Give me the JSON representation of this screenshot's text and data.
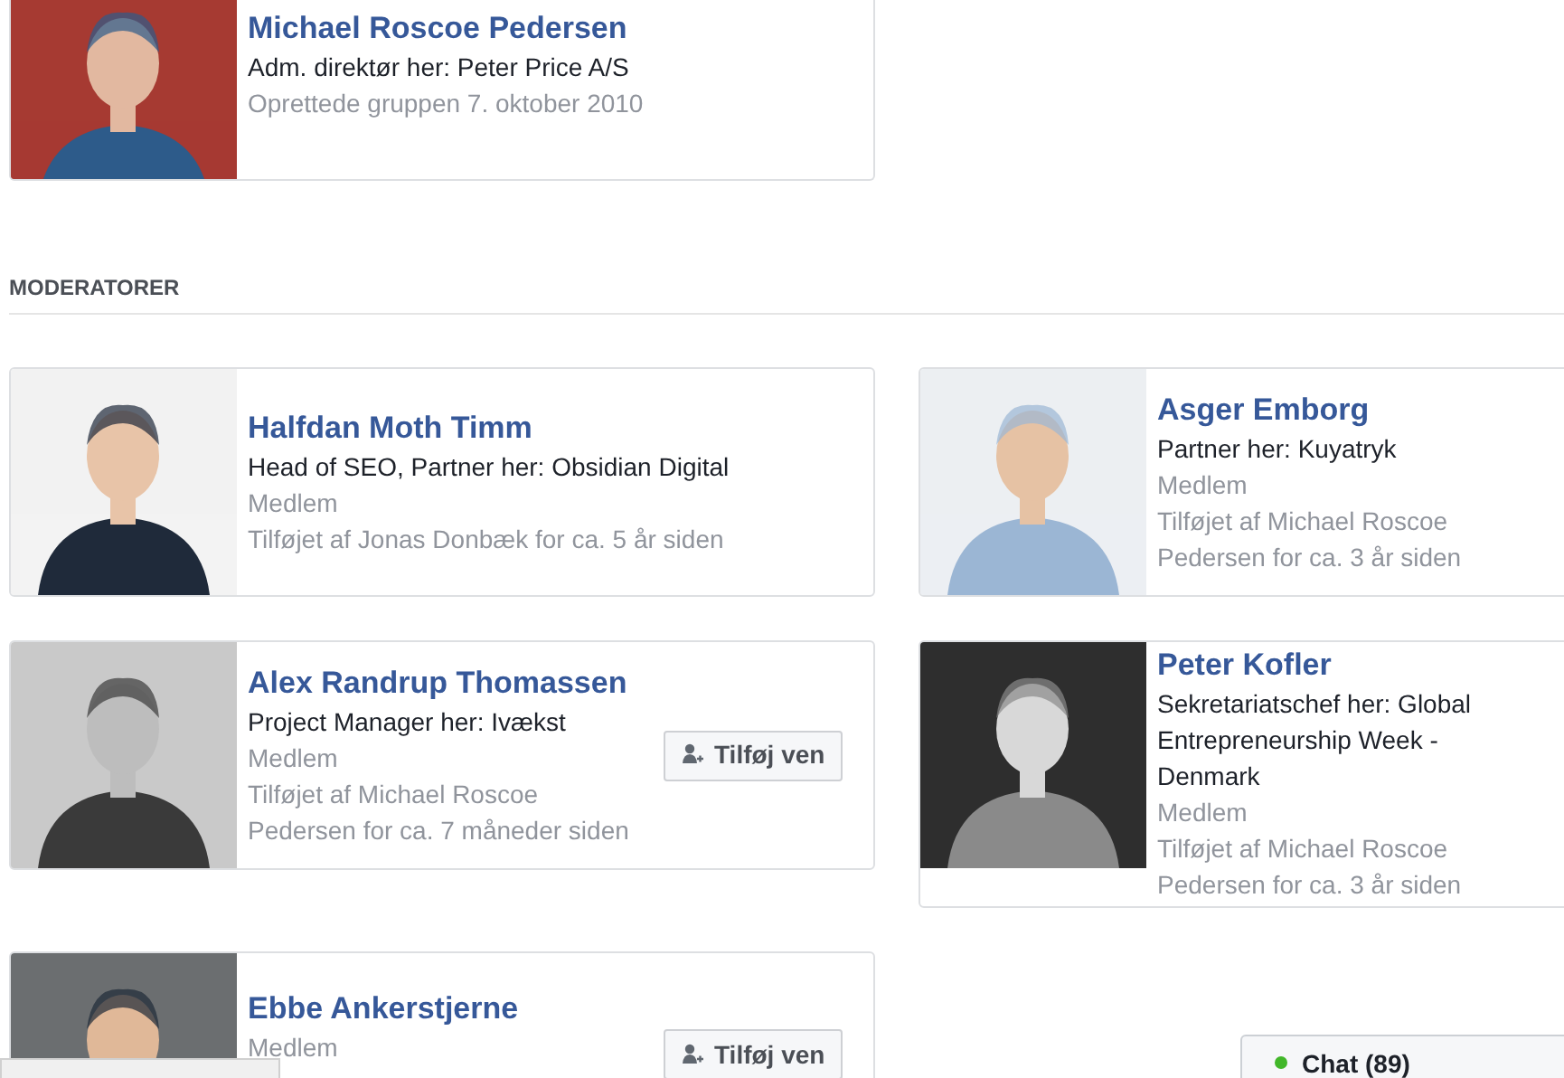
{
  "owner": {
    "name": "Michael Roscoe Pedersen",
    "title": "Adm. direktør her: Peter Price A/S",
    "note": "Oprettede gruppen 7. oktober 2010"
  },
  "section_heading": "MODERATORER",
  "moderators": [
    {
      "name": "Halfdan Moth Timm",
      "lines": [
        {
          "kind": "title",
          "text": "Head of SEO, Partner her: Obsidian Digital"
        },
        {
          "kind": "muted",
          "text": "Medlem"
        },
        {
          "kind": "muted",
          "text": "Tilføjet af Jonas Donbæk for ca. 5 år siden"
        }
      ]
    },
    {
      "name": "Asger Emborg",
      "lines": [
        {
          "kind": "title",
          "text": "Partner her: Kuyatryk"
        },
        {
          "kind": "muted",
          "text": "Medlem"
        },
        {
          "kind": "muted",
          "text": "Tilføjet af Michael Roscoe Pedersen for ca. 3 år siden"
        }
      ]
    },
    {
      "name": "Alex Randrup Thomassen",
      "lines": [
        {
          "kind": "title",
          "text": "Project Manager her: Ivækst"
        },
        {
          "kind": "muted",
          "text": "Medlem"
        },
        {
          "kind": "muted",
          "text": "Tilføjet af Michael Roscoe Pedersen for ca. 7 måneder siden"
        }
      ],
      "add_button": "Tilføj ven"
    },
    {
      "name": "Peter Kofler",
      "lines": [
        {
          "kind": "title",
          "text": "Sekretariatschef her: Global Entrepreneurship Week - Denmark"
        },
        {
          "kind": "muted",
          "text": "Medlem"
        },
        {
          "kind": "muted",
          "text": "Tilføjet af Michael Roscoe Pedersen for ca. 3 år siden"
        }
      ]
    },
    {
      "name": "Ebbe Ankerstjerne",
      "lines": [
        {
          "kind": "muted",
          "text": "Medlem"
        }
      ],
      "add_button": "Tilføj ven"
    }
  ],
  "chat": {
    "label": "Chat (89)",
    "online": true
  }
}
